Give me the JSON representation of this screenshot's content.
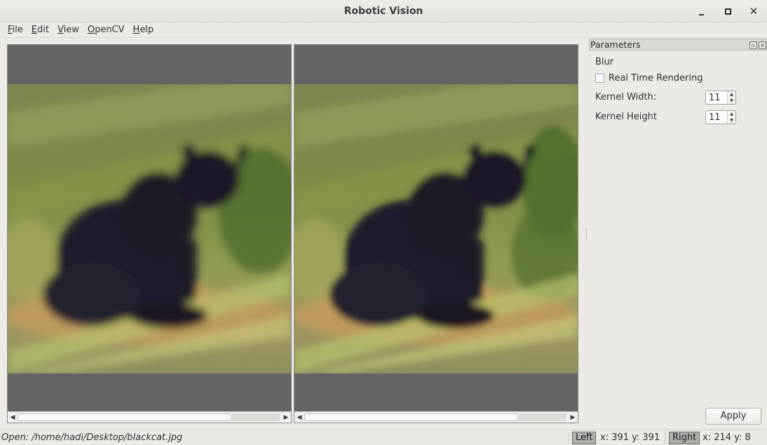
{
  "window": {
    "title": "Robotic Vision",
    "minimize_icon": "minimize-icon",
    "maximize_icon": "maximize-icon",
    "close_glyph": "✕"
  },
  "menu": [
    {
      "label": "File",
      "mnemonic": "F",
      "rest": "ile"
    },
    {
      "label": "Edit",
      "mnemonic": "E",
      "rest": "dit"
    },
    {
      "label": "View",
      "mnemonic": "V",
      "rest": "iew"
    },
    {
      "label": "OpenCV",
      "mnemonic": "O",
      "rest": "penCV"
    },
    {
      "label": "Help",
      "mnemonic": "H",
      "rest": "elp"
    }
  ],
  "viewers": {
    "left": {
      "image_subject": "blurred black cat sitting on rock with grass background",
      "background": "#646464"
    },
    "right": {
      "image_subject": "blurred black cat sitting on rock with grass background",
      "background": "#646464"
    },
    "scroll_left_glyph": "◀",
    "scroll_right_glyph": "▶"
  },
  "parameters": {
    "title": "Parameters",
    "float_glyph": "▫",
    "close_glyph": "×",
    "operation": "Blur",
    "real_time_label": "Real Time Rendering",
    "real_time_checked": false,
    "kernel_width_label": "Kernel Width:",
    "kernel_width_value": "11",
    "kernel_height_label": "Kernel Height",
    "kernel_height_value": "11",
    "spin_up_glyph": "▲",
    "spin_down_glyph": "▼",
    "apply_label": "Apply"
  },
  "status": {
    "message": "Open: /home/hadi/Desktop/blackcat.jpg",
    "left_tag": "Left",
    "left_coords": "x:  391  y:  391",
    "right_tag": "Right",
    "right_coords": "x:  214  y:  8"
  },
  "colors": {
    "window_bg": "#edeae6",
    "viewer_bg": "#646464",
    "tag_bg": "#b2afab"
  }
}
